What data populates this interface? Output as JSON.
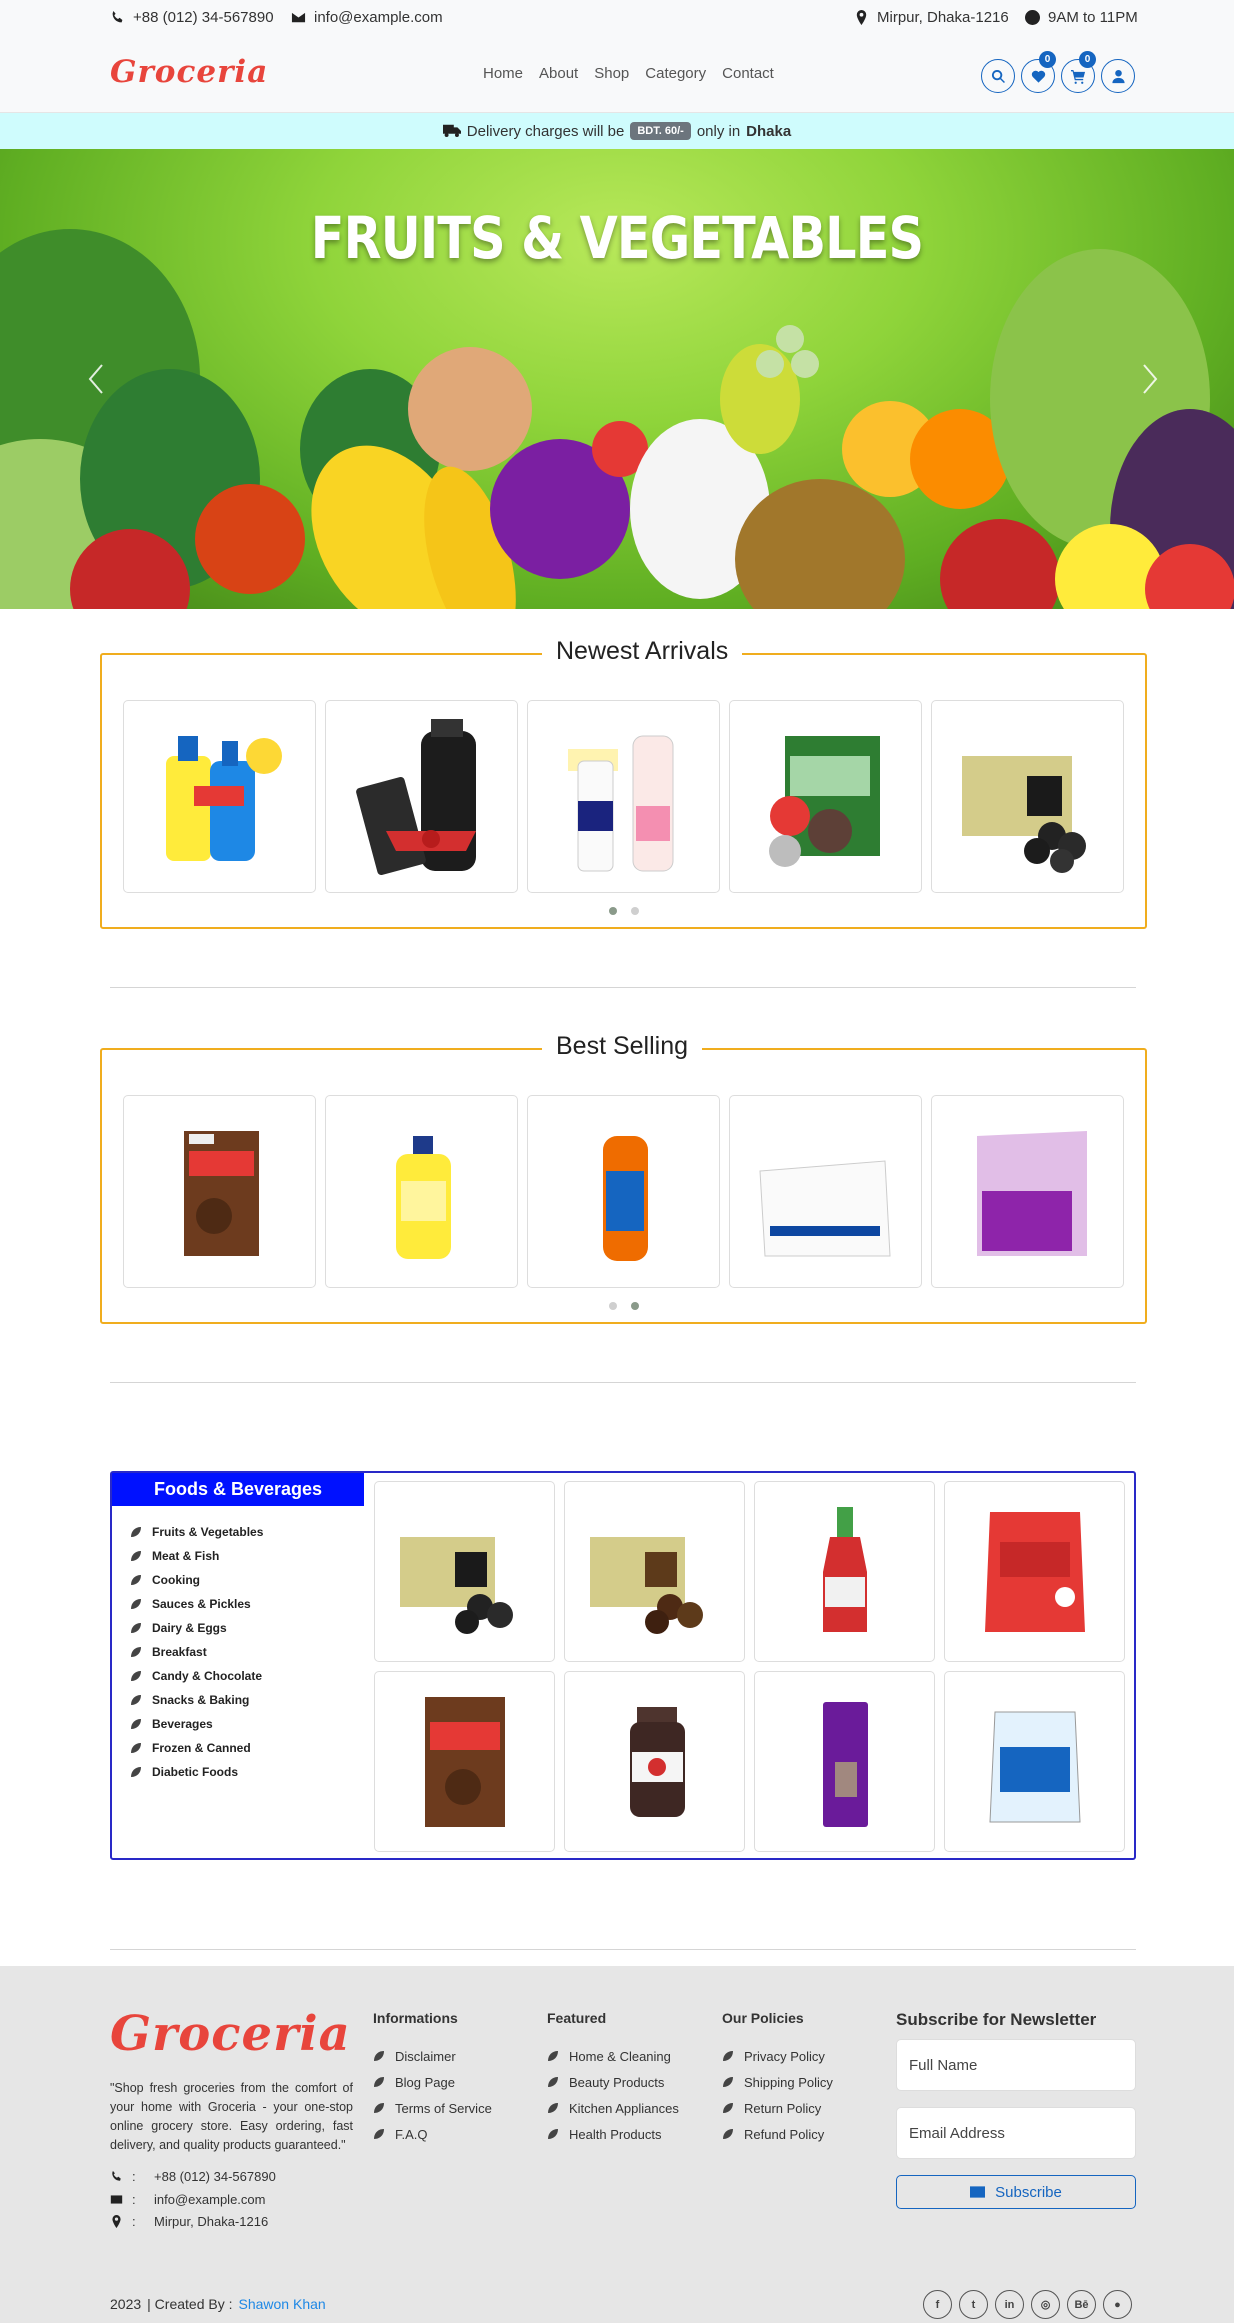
{
  "topbar": {
    "phone": "+88 (012) 34-567890",
    "email": "info@example.com",
    "location": "Mirpur, Dhaka-1216",
    "hours": "9AM to 11PM"
  },
  "nav": {
    "logo": "Groceria",
    "links": [
      "Home",
      "About",
      "Shop",
      "Category",
      "Contact"
    ],
    "wishlist_count": "0",
    "cart_count": "0"
  },
  "delivery": {
    "prefix": "Delivery charges will be",
    "amount": "BDT. 60/-",
    "middle": "only in",
    "city": "Dhaka"
  },
  "hero": {
    "title": "FRUITS & VEGETABLES"
  },
  "newest": {
    "title": "Newest Arrivals",
    "products": [
      "cleaner-bottles",
      "studio-x-set",
      "dove-lotion",
      "snack-pack",
      "dates-box"
    ]
  },
  "best": {
    "title": "Best Selling",
    "products": [
      "koko-krunch",
      "savlon-bottle",
      "horlicks-jar",
      "dove-soap",
      "odonil-pack"
    ]
  },
  "category": {
    "title": "Foods & Beverages",
    "items": [
      "Fruits & Vegetables",
      "Meat & Fish",
      "Cooking",
      "Sauces & Pickles",
      "Dairy & Eggs",
      "Breakfast",
      "Candy & Chocolate",
      "Snacks & Baking",
      "Beverages",
      "Frozen & Canned",
      "Diabetic Foods"
    ]
  },
  "footer": {
    "logo": "Groceria",
    "description": "\"Shop fresh groceries from the comfort of your home with Groceria - your one-stop online grocery store. Easy ordering, fast delivery, and quality products guaranteed.\"",
    "phone": "+88 (012) 34-567890",
    "email": "info@example.com",
    "address": "Mirpur, Dhaka-1216",
    "sep": ":",
    "info_title": "Informations",
    "info_links": [
      "Disclaimer",
      "Blog Page",
      "Terms of Service",
      "F.A.Q"
    ],
    "featured_title": "Featured",
    "featured_links": [
      "Home & Cleaning",
      "Beauty Products",
      "Kitchen Appliances",
      "Health Products"
    ],
    "policy_title": "Our Policies",
    "policy_links": [
      "Privacy Policy",
      "Shipping Policy",
      "Return Policy",
      "Refund Policy"
    ],
    "newsletter_title": "Subscribe for Newsletter",
    "name_placeholder": "Full Name",
    "email_placeholder": "Email Address",
    "subscribe_label": "Subscribe",
    "year": "2023",
    "created_by": "| Created By :",
    "author": "Shawon Khan",
    "socials": [
      "facebook-icon",
      "twitter-icon",
      "linkedin-icon",
      "instagram-icon",
      "behance-icon",
      "github-icon"
    ]
  },
  "colors": {
    "brand": "#e8453c",
    "accent": "#1565c0",
    "section_border": "#f0ad1e",
    "category_head": "#0011ff"
  }
}
